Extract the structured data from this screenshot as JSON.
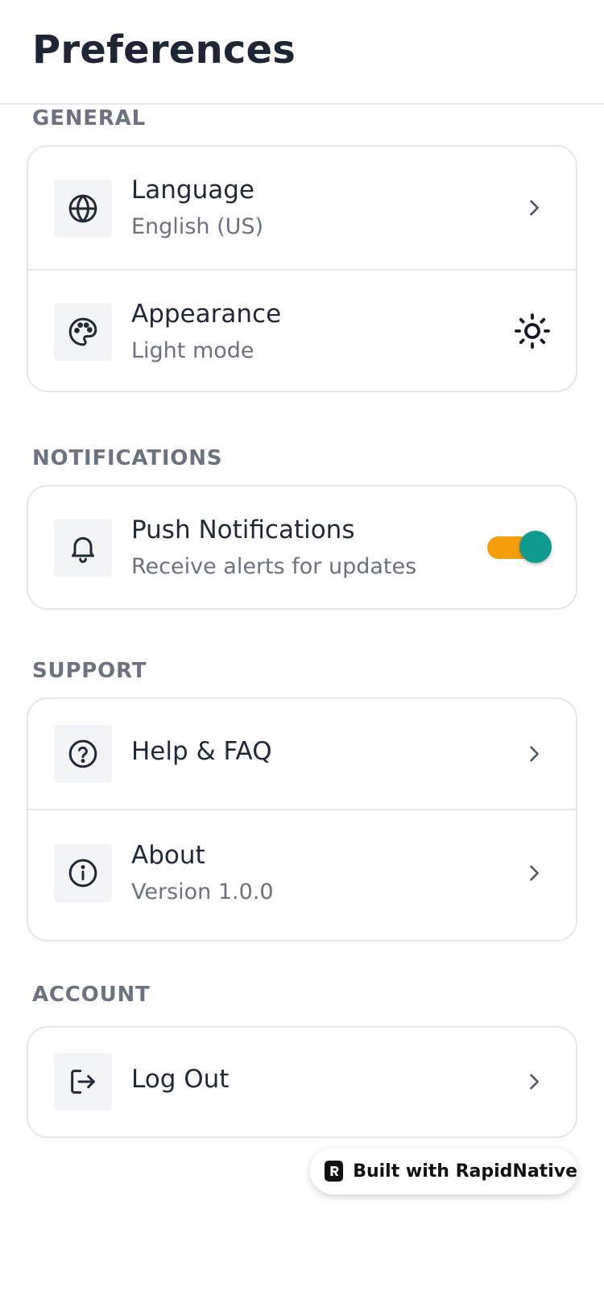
{
  "header": {
    "title": "Preferences"
  },
  "sections": {
    "general": {
      "label": "GENERAL",
      "language": {
        "title": "Language",
        "subtitle": "English (US)",
        "icon": "globe-icon"
      },
      "appearance": {
        "title": "Appearance",
        "subtitle": "Light mode",
        "icon": "palette-icon",
        "mode_icon": "sun-icon"
      }
    },
    "notifications": {
      "label": "NOTIFICATIONS",
      "push": {
        "title": "Push Notifications",
        "subtitle": "Receive alerts for updates",
        "icon": "bell-icon",
        "enabled": true
      }
    },
    "support": {
      "label": "SUPPORT",
      "help": {
        "title": "Help & FAQ",
        "icon": "help-circle-icon"
      },
      "about": {
        "title": "About",
        "subtitle": "Version 1.0.0",
        "icon": "info-icon"
      }
    },
    "account": {
      "label": "ACCOUNT",
      "logout": {
        "title": "Log Out",
        "icon": "logout-icon"
      }
    }
  },
  "badge": {
    "text": "Built with RapidNative"
  },
  "colors": {
    "toggle_track": "#f59e0b",
    "toggle_knob": "#0f9b8e",
    "section_label": "#6b7280",
    "title_text": "#1e2535"
  }
}
